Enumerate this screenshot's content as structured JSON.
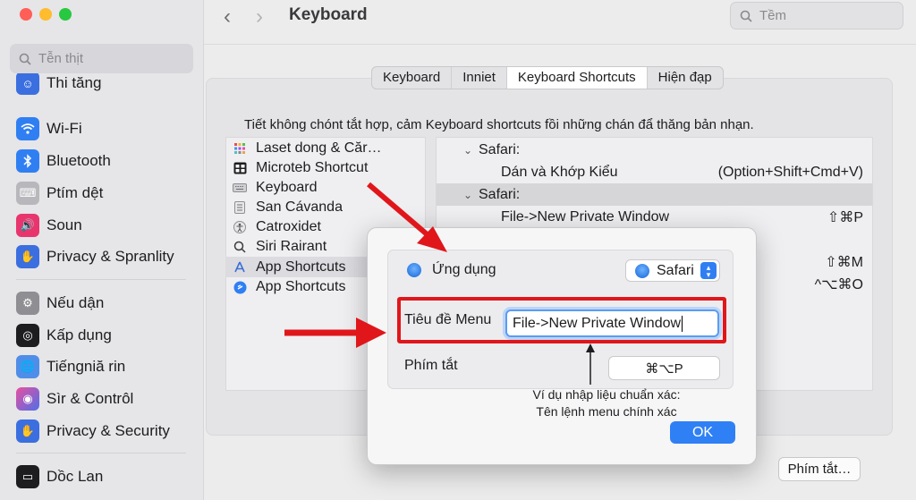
{
  "window": {
    "title": "Keyboard",
    "back_label": "‹",
    "forward_label": "›",
    "search_placeholder": "Tềm"
  },
  "sidebar": {
    "search_placeholder": "Tễn thịt",
    "items": [
      {
        "label": "Thi tăng",
        "icon": "accessibility-icon",
        "color": "#3b6fe0"
      },
      {
        "label": "Wi-Fi",
        "icon": "wifi-icon",
        "color": "#2f7ff3"
      },
      {
        "label": "Bluetooth",
        "icon": "bluetooth-icon",
        "color": "#2f7ff3"
      },
      {
        "label": "Ptím dệt",
        "icon": "keyboard-icon",
        "color": "#9a9a9e"
      },
      {
        "label": "Soun",
        "icon": "sound-icon",
        "color": "#e8356d"
      },
      {
        "label": "Privacy & Spranlity",
        "icon": "hand-icon",
        "color": "#3b6fe0"
      },
      {
        "label": "Nếu dận",
        "icon": "gear-icon",
        "color": "#8e8e93"
      },
      {
        "label": "Kấp dụng",
        "icon": "compass-icon",
        "color": "#1d1d1f"
      },
      {
        "label": "Tiếngniă rin",
        "icon": "globe-icon",
        "color": "#4f8ee8"
      },
      {
        "label": "Sìr & Contrôl",
        "icon": "siri-icon",
        "color": "#7a3fd0"
      },
      {
        "label": "Privacy & Security",
        "icon": "hand-icon",
        "color": "#3b6fe0"
      },
      {
        "label": "Dồc Lan",
        "icon": "dock-icon",
        "color": "#1d1d1f"
      }
    ]
  },
  "tabs": [
    {
      "label": "Keyboard",
      "active": false
    },
    {
      "label": "Inniet",
      "active": false
    },
    {
      "label": "Keyboard Shortcuts",
      "active": true
    },
    {
      "label": "Hiện đạp",
      "active": false
    }
  ],
  "description": "Tiết không chónt tắt hợp, cảm Keyboard shortcuts fồi những chán đẩ thăng bản nhạn.",
  "categories": [
    {
      "label": "Laset dong & Căr…",
      "icon": "launchpad-icon"
    },
    {
      "label": "Microteb Shortcut",
      "icon": "mission-control-icon"
    },
    {
      "label": "Keyboard",
      "icon": "keyboard-icon"
    },
    {
      "label": "San Cávanda",
      "icon": "list-icon"
    },
    {
      "label": "Catroxidet",
      "icon": "accessibility-icon"
    },
    {
      "label": "Siri Rairant",
      "icon": "search-icon"
    },
    {
      "label": "App Shortcuts",
      "icon": "app-store-icon",
      "selected": true
    },
    {
      "label": "App Shortcuts",
      "icon": "app-shortcuts-icon"
    }
  ],
  "shortcuts": [
    {
      "group": "Safari:",
      "highlight": false
    },
    {
      "item": "Dán và Khớp Kiểu",
      "keys": "(Option+Shift+Cmd+V)"
    },
    {
      "group": "Safari:",
      "highlight": true
    },
    {
      "item": "File->New Private Window",
      "keys": "⇧⌘P"
    },
    {
      "item": "",
      "keys": "⇧⌘M"
    },
    {
      "item": "",
      "keys": "^⌥⌘O"
    }
  ],
  "dialog": {
    "app_label": "Ứng dụng",
    "app_value": "Safari",
    "menu_title_label": "Tiêu đề Menu",
    "menu_title_value": "File->New Private Window",
    "shortcut_label": "Phím tắt",
    "shortcut_value": "⌘⌥P",
    "note_line1": "Ví dụ nhập liệu chuẩn xác:",
    "note_line2": "Tên lệnh menu chính xác",
    "ok_label": "OK"
  },
  "bottom_button": "Phím tắt…",
  "colors": {
    "accent": "#2f80f5",
    "annotation_red": "#e0161b"
  }
}
